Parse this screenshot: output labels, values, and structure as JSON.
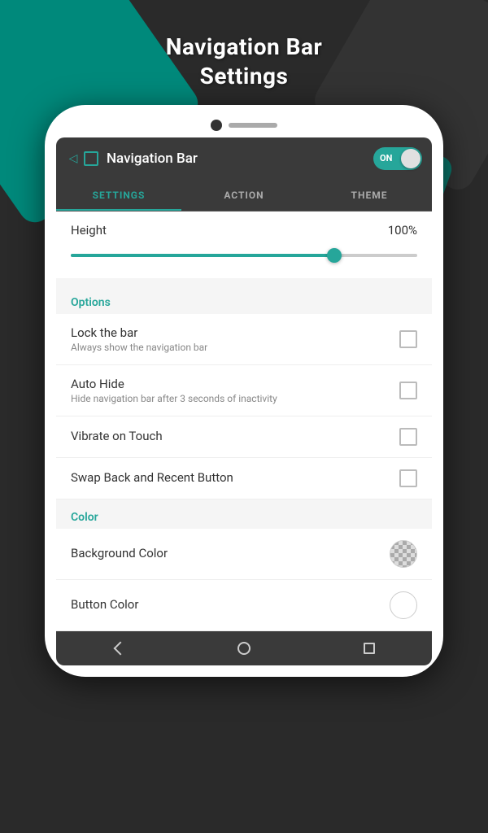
{
  "page": {
    "title_line1": "Navigation Bar",
    "title_line2": "Settings"
  },
  "header": {
    "icon_label": "nav-icon",
    "title": "Navigation Bar",
    "toggle_label": "ON",
    "toggle_state": true
  },
  "tabs": [
    {
      "id": "settings",
      "label": "SETTINGS",
      "active": true
    },
    {
      "id": "action",
      "label": "ACTION",
      "active": false
    },
    {
      "id": "theme",
      "label": "THEME",
      "active": false
    }
  ],
  "height_section": {
    "label": "Height",
    "value": "100%",
    "slider_percent": 76
  },
  "options_section": {
    "header": "Options",
    "items": [
      {
        "id": "lock-bar",
        "title": "Lock the bar",
        "subtitle": "Always show the navigation bar",
        "checked": false
      },
      {
        "id": "auto-hide",
        "title": "Auto Hide",
        "subtitle": "Hide navigation bar after 3 seconds of inactivity",
        "checked": false
      },
      {
        "id": "vibrate-touch",
        "title": "Vibrate on Touch",
        "subtitle": "",
        "checked": false
      },
      {
        "id": "swap-buttons",
        "title": "Swap Back and Recent Button",
        "subtitle": "",
        "checked": false
      }
    ]
  },
  "color_section": {
    "header": "Color",
    "items": [
      {
        "id": "background-color",
        "title": "Background Color",
        "color_type": "checker"
      },
      {
        "id": "button-color",
        "title": "Button Color",
        "color_type": "white"
      }
    ]
  },
  "nav_bar": {
    "back_label": "◁",
    "home_label": "○",
    "recent_label": "□"
  }
}
